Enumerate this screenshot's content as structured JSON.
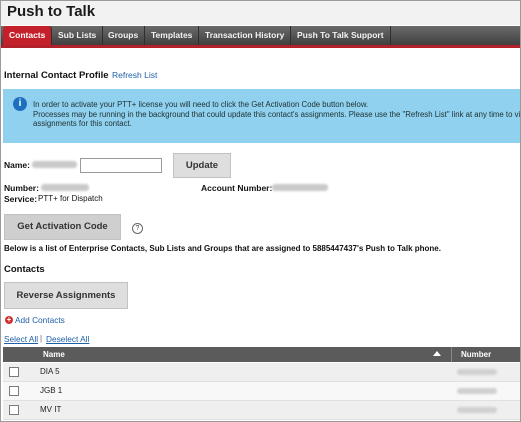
{
  "app": {
    "title": "Push to Talk"
  },
  "tabs": [
    {
      "label": "Contacts",
      "active": true
    },
    {
      "label": "Sub Lists"
    },
    {
      "label": "Groups"
    },
    {
      "label": "Templates"
    },
    {
      "label": "Transaction History"
    },
    {
      "label": "Push To Talk Support"
    }
  ],
  "profile": {
    "section_title": "Internal Contact Profile",
    "refresh_link": "Refresh List"
  },
  "info": {
    "icon": "info-icon",
    "line1": "In order to activate your PTT+ license you will need to click the Get Activation Code button below.",
    "line2": "Processes may be running in the background that could update this contact's assignments. Please use the \"Refresh List\" link at any time to view the",
    "line3": "assignments for this contact."
  },
  "form": {
    "name_label": "Name:",
    "update_button": "Update",
    "number_label": "Number:",
    "account_label": "Account Number:",
    "service_label": "Service:",
    "service_value": "PTT+ for Dispatch",
    "activation_button": "Get Activation Code",
    "help_icon": "?"
  },
  "description": "Below is a list of Enterprise Contacts, Sub Lists and Groups that are assigned to 5885447437's Push to Talk phone.",
  "contacts": {
    "heading": "Contacts",
    "reverse_button": "Reverse Assignments",
    "add_contacts": "Add Contacts",
    "select_all": "Select All",
    "separator": "|",
    "deselect_all": "Deselect All",
    "columns": [
      "Name",
      "Number"
    ],
    "rows": [
      {
        "name": "DIA 5"
      },
      {
        "name": "JGB 1"
      },
      {
        "name": "MV IT"
      }
    ]
  },
  "colors": {
    "accent": "#c4202b",
    "tabbar": "#4a4a4a",
    "info_bg": "#8fd1ef",
    "link": "#1f5fa8"
  }
}
